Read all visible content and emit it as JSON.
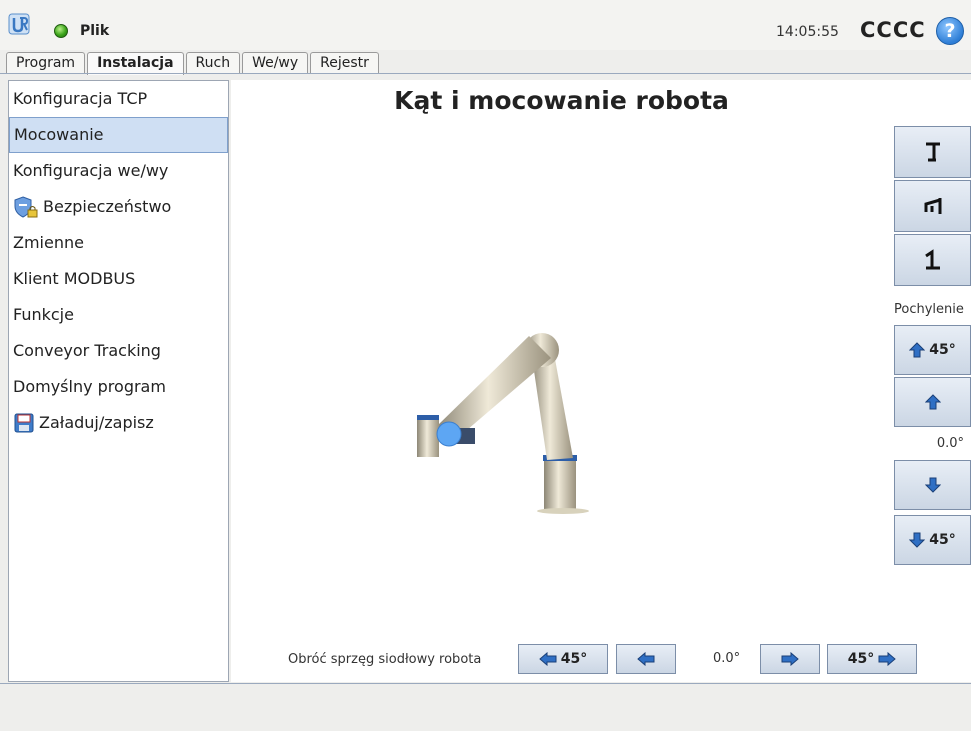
{
  "header": {
    "file_label": "Plik",
    "clock": "14:05:55",
    "robot_name": "CCCC",
    "help_glyph": "?",
    "status_color": "#3ca51b"
  },
  "tabs": [
    {
      "label": "Program"
    },
    {
      "label": "Instalacja"
    },
    {
      "label": "Ruch"
    },
    {
      "label": "We/wy"
    },
    {
      "label": "Rejestr"
    }
  ],
  "sidebar": {
    "items": [
      {
        "label": "Konfiguracja TCP"
      },
      {
        "label": "Mocowanie"
      },
      {
        "label": "Konfiguracja we/wy"
      },
      {
        "label": "Bezpieczeństwo",
        "icon": "shield-lock-icon"
      },
      {
        "label": "Zmienne"
      },
      {
        "label": "Klient MODBUS"
      },
      {
        "label": "Funkcje"
      },
      {
        "label": "Conveyor Tracking"
      },
      {
        "label": "Domyślny program"
      },
      {
        "label": "Załaduj/zapisz",
        "icon": "floppy-disk-icon"
      }
    ],
    "selected": "Mocowanie"
  },
  "main": {
    "title": "Kąt i mocowanie robota",
    "mount_buttons": [
      "floor-mount-icon",
      "wall-mount-icon",
      "ceiling-mount-icon"
    ],
    "tilt": {
      "label": "Pochylenie",
      "up45_label": "45°",
      "down45_label": "45°",
      "value": "0.0°"
    },
    "rotate": {
      "label": "Obróć sprzęg siodłowy robota",
      "left45_label": "45°",
      "right45_label": "45°",
      "value": "0.0°"
    }
  },
  "colors": {
    "accent": "#2e7ed6",
    "selection": "#cfdff3"
  }
}
